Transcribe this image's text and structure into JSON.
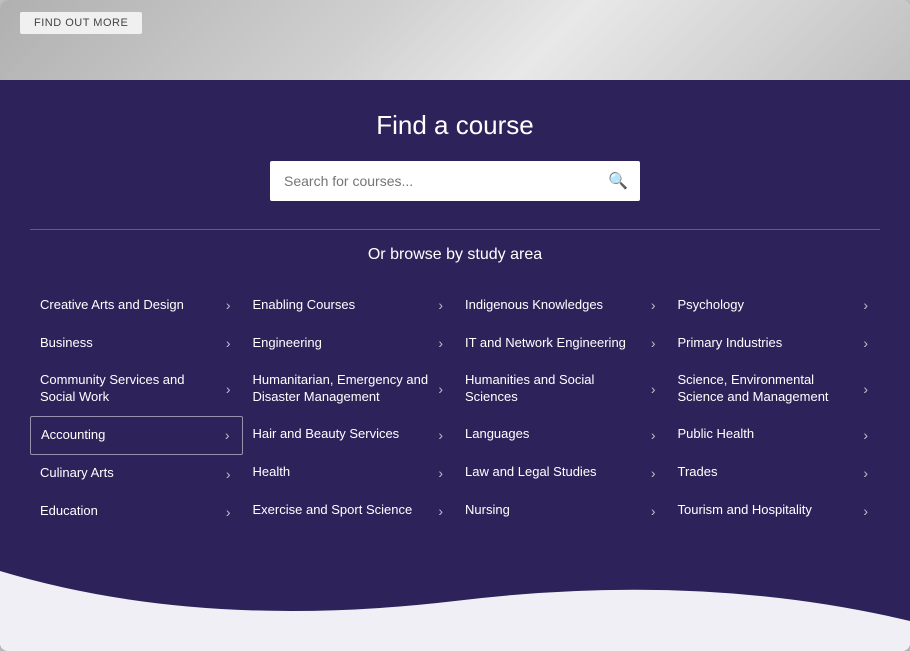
{
  "hero": {
    "find_out_more": "FIND OUT MORE"
  },
  "main": {
    "title": "Find a course",
    "search": {
      "placeholder": "Search for courses..."
    },
    "browse_label": "Or browse by study area",
    "columns": [
      {
        "items": [
          {
            "label": "Creative Arts and Design",
            "highlighted": false
          },
          {
            "label": "Business",
            "highlighted": false
          },
          {
            "label": "Community Services and Social Work",
            "highlighted": false
          },
          {
            "label": "Accounting",
            "highlighted": true
          },
          {
            "label": "Culinary Arts",
            "highlighted": false
          },
          {
            "label": "Education",
            "highlighted": false
          }
        ]
      },
      {
        "items": [
          {
            "label": "Enabling Courses",
            "highlighted": false
          },
          {
            "label": "Engineering",
            "highlighted": false
          },
          {
            "label": "Humanitarian, Emergency and Disaster Management",
            "highlighted": false
          },
          {
            "label": "Hair and Beauty Services",
            "highlighted": false
          },
          {
            "label": "Health",
            "highlighted": false
          },
          {
            "label": "Exercise and Sport Science",
            "highlighted": false
          }
        ]
      },
      {
        "items": [
          {
            "label": "Indigenous Knowledges",
            "highlighted": false
          },
          {
            "label": "IT and Network Engineering",
            "highlighted": false
          },
          {
            "label": "Humanities and Social Sciences",
            "highlighted": false
          },
          {
            "label": "Languages",
            "highlighted": false
          },
          {
            "label": "Law and Legal Studies",
            "highlighted": false
          },
          {
            "label": "Nursing",
            "highlighted": false
          }
        ]
      },
      {
        "items": [
          {
            "label": "Psychology",
            "highlighted": false
          },
          {
            "label": "Primary Industries",
            "highlighted": false
          },
          {
            "label": "Science, Environmental Science and Management",
            "highlighted": false
          },
          {
            "label": "Public Health",
            "highlighted": false
          },
          {
            "label": "Trades",
            "highlighted": false
          },
          {
            "label": "Tourism and Hospitality",
            "highlighted": false
          }
        ]
      }
    ]
  }
}
